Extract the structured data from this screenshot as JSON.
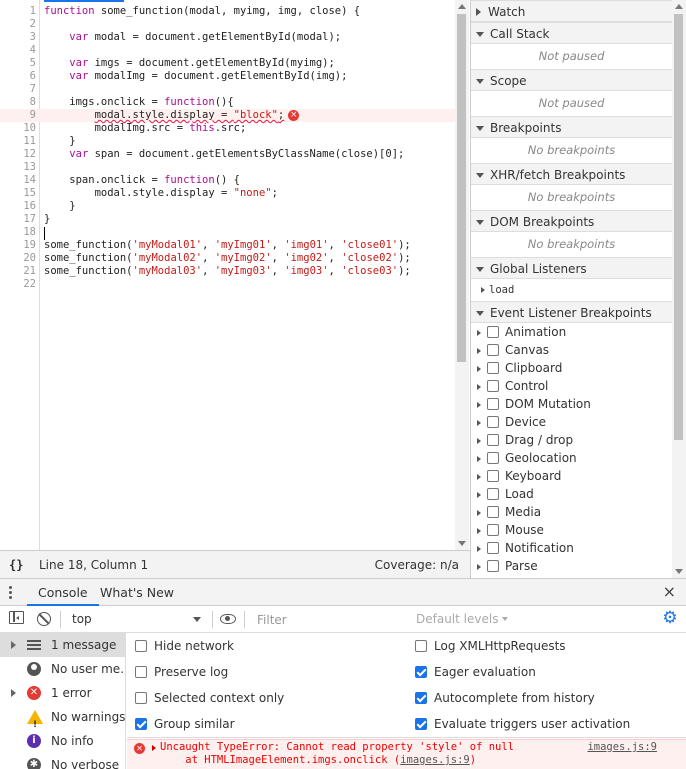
{
  "editor": {
    "lines": [
      {
        "n": "1",
        "parts": [
          {
            "t": "function",
            "c": "kw"
          },
          {
            "t": " some_function(modal, myimg, img, close) {"
          }
        ]
      },
      {
        "n": "2",
        "parts": []
      },
      {
        "n": "3",
        "parts": [
          {
            "t": "    "
          },
          {
            "t": "var",
            "c": "kw"
          },
          {
            "t": " modal = document.getElementById(modal);"
          }
        ]
      },
      {
        "n": "4",
        "parts": []
      },
      {
        "n": "5",
        "parts": [
          {
            "t": "    "
          },
          {
            "t": "var",
            "c": "kw"
          },
          {
            "t": " imgs = document.getElementById(myimg);"
          }
        ]
      },
      {
        "n": "6",
        "parts": [
          {
            "t": "    "
          },
          {
            "t": "var",
            "c": "kw"
          },
          {
            "t": " modalImg = document.getElementById(img);"
          }
        ]
      },
      {
        "n": "7",
        "parts": []
      },
      {
        "n": "8",
        "parts": [
          {
            "t": "    imgs.onclick = "
          },
          {
            "t": "function",
            "c": "kw"
          },
          {
            "t": "(){"
          }
        ]
      },
      {
        "n": "9",
        "error": true,
        "parts": [
          {
            "t": "        "
          },
          {
            "t": "modal.style.display = ",
            "c": "squiggle"
          },
          {
            "t": "\"block\"",
            "c": "str squiggle"
          },
          {
            "t": ";",
            "c": "squiggle"
          }
        ]
      },
      {
        "n": "10",
        "parts": [
          {
            "t": "        modalImg.src = "
          },
          {
            "t": "this",
            "c": "kw"
          },
          {
            "t": ".src;"
          }
        ]
      },
      {
        "n": "11",
        "parts": [
          {
            "t": "    }"
          }
        ]
      },
      {
        "n": "12",
        "parts": [
          {
            "t": "    "
          },
          {
            "t": "var",
            "c": "kw"
          },
          {
            "t": " span = document.getElementsByClassName(close)[0];"
          }
        ]
      },
      {
        "n": "13",
        "parts": []
      },
      {
        "n": "14",
        "parts": [
          {
            "t": "    span.onclick = "
          },
          {
            "t": "function",
            "c": "kw"
          },
          {
            "t": "() {"
          }
        ]
      },
      {
        "n": "15",
        "parts": [
          {
            "t": "        modal.style.display = "
          },
          {
            "t": "\"none\"",
            "c": "str"
          },
          {
            "t": ";"
          }
        ]
      },
      {
        "n": "16",
        "parts": [
          {
            "t": "    }"
          }
        ]
      },
      {
        "n": "17",
        "parts": [
          {
            "t": "}"
          }
        ]
      },
      {
        "n": "18",
        "parts": []
      },
      {
        "n": "19",
        "parts": [
          {
            "t": "some_function("
          },
          {
            "t": "'myModal01'",
            "c": "str"
          },
          {
            "t": ", "
          },
          {
            "t": "'myImg01'",
            "c": "str"
          },
          {
            "t": ", "
          },
          {
            "t": "'img01'",
            "c": "str"
          },
          {
            "t": ", "
          },
          {
            "t": "'close01'",
            "c": "str"
          },
          {
            "t": ");"
          }
        ]
      },
      {
        "n": "20",
        "parts": [
          {
            "t": "some_function("
          },
          {
            "t": "'myModal02'",
            "c": "str"
          },
          {
            "t": ", "
          },
          {
            "t": "'myImg02'",
            "c": "str"
          },
          {
            "t": ", "
          },
          {
            "t": "'img02'",
            "c": "str"
          },
          {
            "t": ", "
          },
          {
            "t": "'close02'",
            "c": "str"
          },
          {
            "t": ");"
          }
        ]
      },
      {
        "n": "21",
        "parts": [
          {
            "t": "some_function("
          },
          {
            "t": "'myModal03'",
            "c": "str"
          },
          {
            "t": ", "
          },
          {
            "t": "'myImg03'",
            "c": "str"
          },
          {
            "t": ", "
          },
          {
            "t": "'img03'",
            "c": "str"
          },
          {
            "t": ", "
          },
          {
            "t": "'close03'",
            "c": "str"
          },
          {
            "t": ");"
          }
        ]
      },
      {
        "n": "22",
        "parts": []
      }
    ],
    "error_marker": "×"
  },
  "status_bar": {
    "format_icon": "{}",
    "cursor_position": "Line 18, Column 1",
    "coverage": "Coverage: n/a"
  },
  "debugger": {
    "watch": "Watch",
    "call_stack": "Call Stack",
    "call_stack_empty": "Not paused",
    "scope": "Scope",
    "scope_empty": "Not paused",
    "breakpoints": "Breakpoints",
    "breakpoints_empty": "No breakpoints",
    "xhr": "XHR/fetch Breakpoints",
    "xhr_empty": "No breakpoints",
    "dom": "DOM Breakpoints",
    "dom_empty": "No breakpoints",
    "global_listeners": "Global Listeners",
    "global_listener_item": "load",
    "event_listener_bps": "Event Listener Breakpoints",
    "event_categories": [
      "Animation",
      "Canvas",
      "Clipboard",
      "Control",
      "DOM Mutation",
      "Device",
      "Drag / drop",
      "Geolocation",
      "Keyboard",
      "Load",
      "Media",
      "Mouse",
      "Notification",
      "Parse"
    ]
  },
  "drawer": {
    "tabs": [
      "Console",
      "What's New"
    ],
    "close": "×"
  },
  "console_toolbar": {
    "context": "top",
    "filter_placeholder": "Filter",
    "levels": "Default levels",
    "settings_icon": "⚙"
  },
  "console_sidebar": [
    {
      "label": "1 message",
      "icon": "list-icon",
      "expandable": true,
      "selected": true
    },
    {
      "label": "No user me...",
      "icon": "user-icon",
      "expandable": false
    },
    {
      "label": "1 error",
      "icon": "error-icon",
      "expandable": true
    },
    {
      "label": "No warnings",
      "icon": "warning-icon",
      "expandable": false
    },
    {
      "label": "No info",
      "icon": "info-icon",
      "expandable": false
    },
    {
      "label": "No verbose",
      "icon": "verbose-icon",
      "expandable": false
    }
  ],
  "console_settings": {
    "left": [
      {
        "label": "Hide network",
        "checked": false
      },
      {
        "label": "Preserve log",
        "checked": false
      },
      {
        "label": "Selected context only",
        "checked": false
      },
      {
        "label": "Group similar",
        "checked": true
      }
    ],
    "right": [
      {
        "label": "Log XMLHttpRequests",
        "checked": false
      },
      {
        "label": "Eager evaluation",
        "checked": true
      },
      {
        "label": "Autocomplete from history",
        "checked": true
      },
      {
        "label": "Evaluate triggers user activation",
        "checked": true
      }
    ]
  },
  "console_message": {
    "line1": "Uncaught TypeError: Cannot read property 'style' of null",
    "line2_prefix": "    at HTMLImageElement.imgs.onclick (",
    "line2_link": "images.js:9",
    "line2_suffix": ")",
    "source": "images.js:9"
  },
  "colors": {
    "accent": "#1a73e8",
    "error": "#e53935",
    "keyword": "#aa0d91",
    "string": "#c41a16"
  }
}
